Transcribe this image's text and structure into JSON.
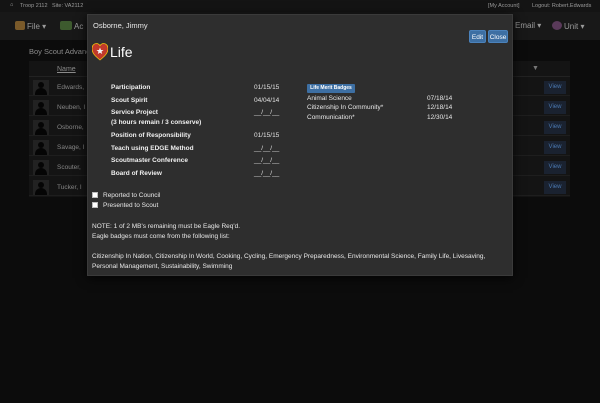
{
  "topbar": {
    "troop": "Troop 2112",
    "site": "Site: VA2112",
    "my_account": "[My Account]",
    "logout": "Logout: Robert.Edwards"
  },
  "nav": {
    "file": "File",
    "activities": "Ac",
    "email": "Email",
    "unit": "Unit"
  },
  "background": {
    "heading": "Boy Scout Advanc",
    "name_header": "Name",
    "rows": [
      {
        "name": "Edwards,",
        "action": "View"
      },
      {
        "name": "Neuben, I",
        "action": "View"
      },
      {
        "name": "Osborne,",
        "action": "View"
      },
      {
        "name": "Savage, I",
        "action": "View"
      },
      {
        "name": "Scouter,",
        "action": "View"
      },
      {
        "name": "Tucker, I",
        "action": "View"
      }
    ]
  },
  "modal": {
    "title": "Osborne, Jimmy",
    "edit_label": "Edit",
    "close_label": "Close",
    "rank": "Life",
    "rank_color": "#c0392b",
    "requirements": [
      {
        "label": "Participation",
        "date": "01/15/15"
      },
      {
        "label": "Scout Spirit",
        "date": "04/04/14"
      },
      {
        "label": "Service Project",
        "sublabel": "(3 hours remain / 3 conserve)",
        "date": "__/__/__"
      },
      {
        "label": "Position of Responsibility",
        "date": "01/15/15"
      },
      {
        "label": "Teach using EDGE Method",
        "date": "__/__/__"
      },
      {
        "label": "Scoutmaster Conference",
        "date": "__/__/__"
      },
      {
        "label": "Board of Review",
        "date": "__/__/__"
      }
    ],
    "merit_badges_header": "Life Merit Badges",
    "merit_badges": [
      {
        "name": "Animal Science",
        "date": "07/18/14"
      },
      {
        "name": "Citizenship In Community*",
        "date": "12/18/14"
      },
      {
        "name": "Communication*",
        "date": "12/30/14"
      }
    ],
    "checkboxes": [
      {
        "label": "Reported to Council",
        "checked": false
      },
      {
        "label": "Presented to Scout",
        "checked": false
      }
    ],
    "note_line1": "NOTE: 1 of 2 MB's remaining must be Eagle Req'd.",
    "note_line2": "Eagle badges must come from the following list:",
    "eagle_list": "Citizenship In Nation, Citizenship In World, Cooking, Cycling, Emergency Preparedness, Environmental Science, Family Life, Livesaving, Personal Management, Sustainability, Swimming"
  }
}
